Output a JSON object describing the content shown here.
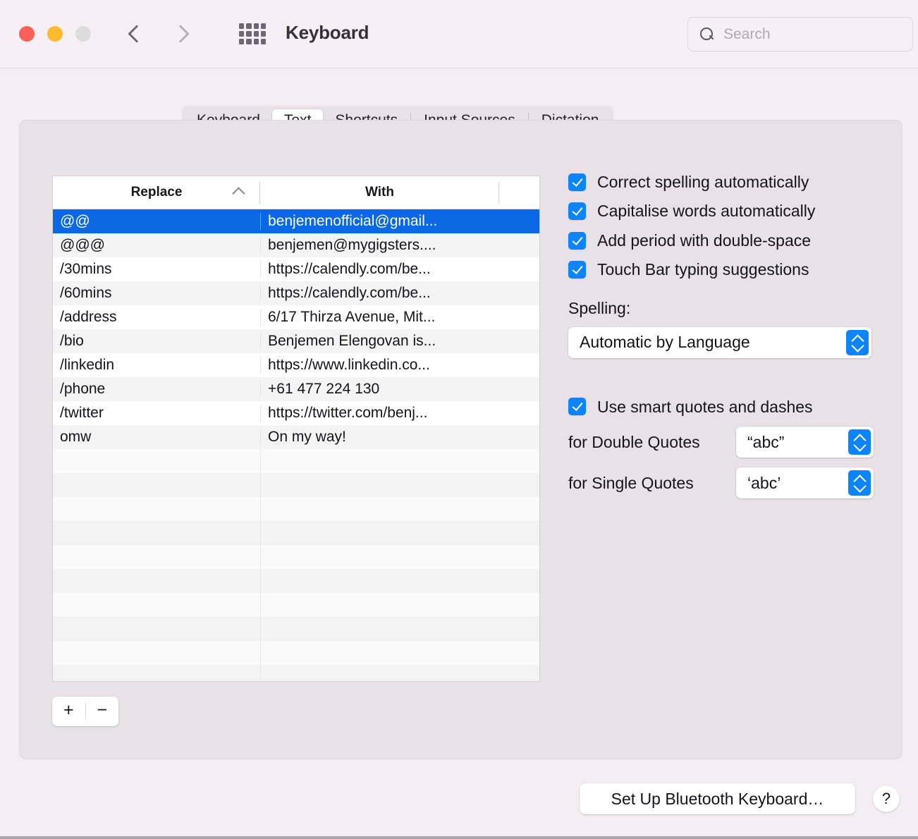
{
  "window": {
    "title": "Keyboard",
    "traffic_lights": [
      "close",
      "minimise",
      "zoom"
    ],
    "back_label": "Back",
    "forward_label": "Forward",
    "grid_label": "Show All",
    "accent_blue": "#0b84fe",
    "selection_blue": "#0b68e3"
  },
  "search": {
    "placeholder": "Search",
    "value": ""
  },
  "tabs": [
    {
      "label": "Keyboard",
      "active": false
    },
    {
      "label": "Text",
      "active": true
    },
    {
      "label": "Shortcuts",
      "active": false
    },
    {
      "label": "Input Sources",
      "active": false
    },
    {
      "label": "Dictation",
      "active": false
    }
  ],
  "table": {
    "columns": [
      "Replace",
      "With"
    ],
    "sort_column": "Replace",
    "sort_direction": "ascending",
    "rows": [
      {
        "replace": "@@",
        "with": "benjemenofficial@gmail...",
        "selected": true
      },
      {
        "replace": "@@@",
        "with": "benjemen@mygigsters....",
        "selected": false
      },
      {
        "replace": "/30mins",
        "with": "https://calendly.com/be...",
        "selected": false
      },
      {
        "replace": "/60mins",
        "with": "https://calendly.com/be...",
        "selected": false
      },
      {
        "replace": "/address",
        "with": "6/17 Thirza Avenue, Mit...",
        "selected": false
      },
      {
        "replace": "/bio",
        "with": "Benjemen Elengovan is...",
        "selected": false
      },
      {
        "replace": "/linkedin",
        "with": "https://www.linkedin.co...",
        "selected": false
      },
      {
        "replace": "/phone",
        "with": "+61 477 224 130",
        "selected": false
      },
      {
        "replace": "/twitter",
        "with": "https://twitter.com/benj...",
        "selected": false
      },
      {
        "replace": "omw",
        "with": "On my way!",
        "selected": false
      }
    ],
    "empty_row_count": 11,
    "add_label": "+",
    "remove_label": "−"
  },
  "options": {
    "checkboxes": [
      {
        "label": "Correct spelling automatically",
        "checked": true
      },
      {
        "label": "Capitalise words automatically",
        "checked": true
      },
      {
        "label": "Add period with double-space",
        "checked": true
      },
      {
        "label": "Touch Bar typing suggestions",
        "checked": true
      }
    ],
    "spelling_label": "Spelling:",
    "spelling_value": "Automatic by Language",
    "smart_quotes": {
      "label": "Use smart quotes and dashes",
      "checked": true
    },
    "double_quotes_label": "for Double Quotes",
    "double_quotes_value": "“abc”",
    "single_quotes_label": "for Single Quotes",
    "single_quotes_value": "‘abc’"
  },
  "footer": {
    "bluetooth_button": "Set Up Bluetooth Keyboard…",
    "help_button": "?"
  }
}
